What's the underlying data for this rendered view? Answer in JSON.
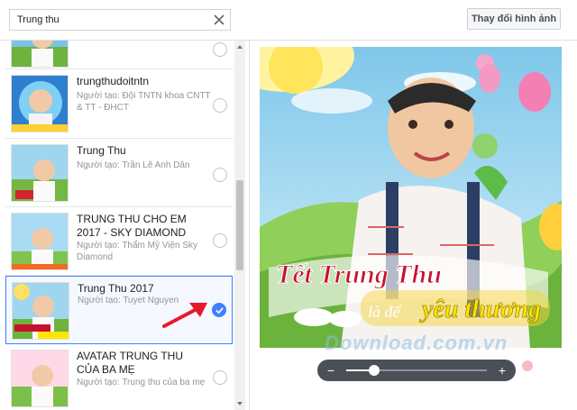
{
  "search": {
    "value": "Trung thu",
    "placeholder": ""
  },
  "toolbar": {
    "change_image_label": "Thay đổi hình ảnh"
  },
  "frames": [
    {
      "title": "",
      "creator": "",
      "selected": false
    },
    {
      "title": "trungthudoitntn",
      "creator": "Người tạo: Đội TNTN khoa CNTT & TT - ĐHCT",
      "selected": false
    },
    {
      "title": "Trung Thu",
      "creator": "Người tạo: Trần Lê Anh Dân",
      "selected": false
    },
    {
      "title": "TRUNG THU CHO EM 2017 - SKY DIAMOND",
      "creator": "Người tạo: Thẩm Mỹ Viện Sky Diamond",
      "selected": false
    },
    {
      "title": "Trung Thu 2017",
      "creator": "Người tạo: Tuyet Nguyen",
      "selected": true
    },
    {
      "title": "AVATAR TRUNG THU CỦA BA MẸ",
      "creator": "Người tạo: Trung thu của ba mẹ",
      "selected": false
    }
  ],
  "preview": {
    "banner_line1": "Tết Trung Thu",
    "banner_line2a": "là để",
    "banner_line2b": "yêu thương"
  },
  "zoom": {
    "level": 0.2,
    "minus_label": "−",
    "plus_label": "+"
  },
  "watermark": {
    "text": "Download.com.vn"
  },
  "colors": {
    "accent": "#4080ff",
    "arrow": "#e8192c",
    "banner_red": "#c8102e",
    "banner_yellow": "#ffe600"
  }
}
